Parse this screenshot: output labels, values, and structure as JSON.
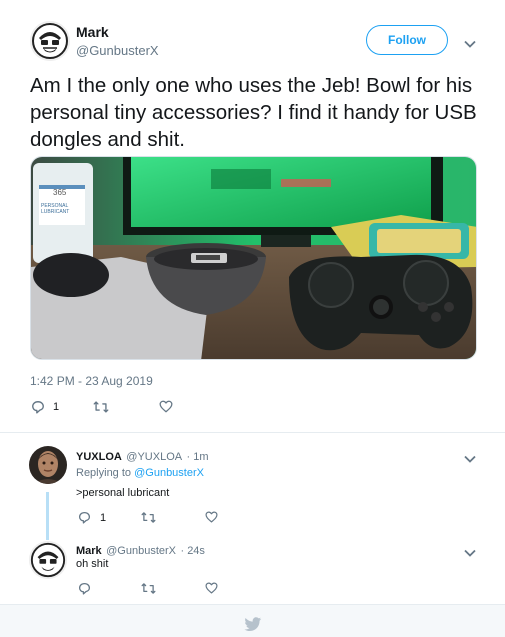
{
  "tweet": {
    "author": {
      "name": "Mark",
      "handle": "@GunbusterX"
    },
    "follow_label": "Follow",
    "text": "Am I the only one who uses the Jeb! Bowl for his personal tiny accessories? I find it handy for USB dongles and shit.",
    "timestamp": "1:42 PM - 23 Aug 2019",
    "reply_count": "1",
    "photo_labels": {
      "bottle_brand": "365",
      "bottle_line1": "PERSONAL",
      "bottle_line2": "LUBRICANT"
    }
  },
  "replies": [
    {
      "name": "YUXLOA",
      "handle": "@YUXLOA",
      "time": "· 1m",
      "replying_prefix": "Replying to",
      "replying_to": "@GunbusterX",
      "text": ">personal lubricant",
      "reply_count": "1"
    },
    {
      "name": "Mark",
      "handle": "@GunbusterX",
      "time": "· 24s",
      "text": "oh shit"
    }
  ],
  "icons": {
    "more": "chevron-down-icon",
    "reply": "reply-icon",
    "retweet": "retweet-icon",
    "like": "heart-icon",
    "footer": "twitter-bird-icon"
  },
  "colors": {
    "accent": "#1da1f2",
    "text": "#14171a",
    "secondary": "#657786",
    "thread_line": "#b8dff6"
  }
}
